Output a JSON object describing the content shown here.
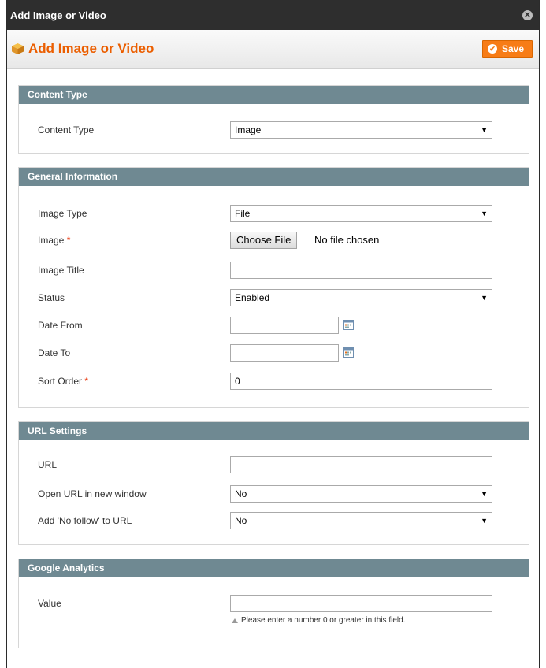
{
  "window": {
    "title": "Add Image or Video"
  },
  "header": {
    "title": "Add Image or Video",
    "save_label": "Save"
  },
  "sections": {
    "content_type": {
      "title": "Content Type",
      "fields": {
        "content_type": {
          "label": "Content Type",
          "value": "Image"
        }
      }
    },
    "general": {
      "title": "General Information",
      "fields": {
        "image_type": {
          "label": "Image Type",
          "value": "File"
        },
        "image": {
          "label": "Image",
          "required": "*",
          "button": "Choose File",
          "status": "No file chosen"
        },
        "image_title": {
          "label": "Image Title",
          "value": ""
        },
        "status": {
          "label": "Status",
          "value": "Enabled"
        },
        "date_from": {
          "label": "Date From",
          "value": ""
        },
        "date_to": {
          "label": "Date To",
          "value": ""
        },
        "sort_order": {
          "label": "Sort Order",
          "required": "*",
          "value": "0"
        }
      }
    },
    "url": {
      "title": "URL Settings",
      "fields": {
        "url": {
          "label": "URL",
          "value": ""
        },
        "new_window": {
          "label": "Open URL in new window",
          "value": "No"
        },
        "nofollow": {
          "label": "Add 'No follow' to URL",
          "value": "No"
        }
      }
    },
    "ga": {
      "title": "Google Analytics",
      "fields": {
        "value": {
          "label": "Value",
          "value": "",
          "note": "Please enter a number 0 or greater in this field."
        }
      }
    }
  },
  "colors": {
    "accent": "#eb5e00",
    "section_header": "#6f8992",
    "save_button": "#f77c16",
    "titlebar": "#2e2e2e"
  }
}
